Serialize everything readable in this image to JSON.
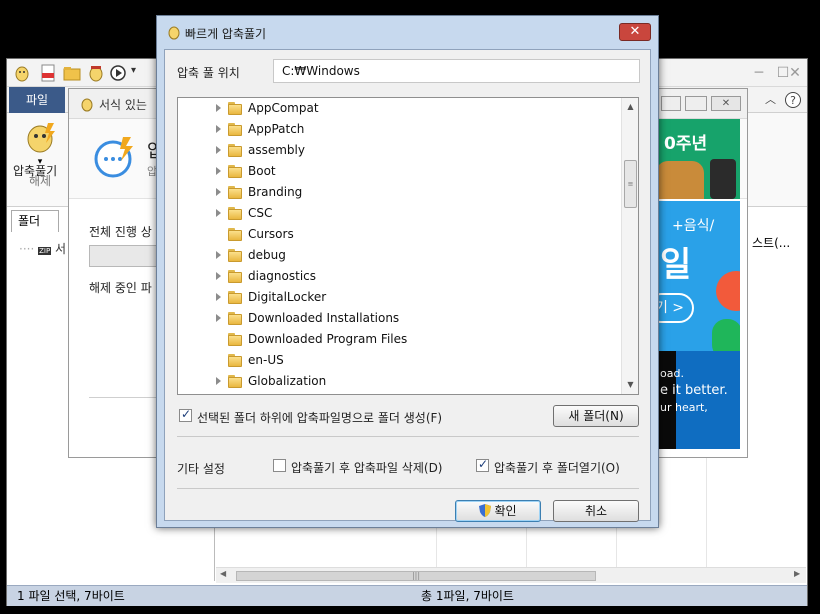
{
  "main_window": {
    "file_tab": "파일",
    "extract_button": "압축풀기",
    "extract_group": "해제",
    "folder_tab": "폴더",
    "tree_item": "서",
    "column_fragment": "스트(...",
    "status_left": "1 파일 선택,  7바이트",
    "status_center": "총 1파일,  7바이트"
  },
  "progress_window": {
    "title": "서식 있는",
    "header_fragment": "압",
    "header_sub": "압",
    "overall_label": "전체 진행 상",
    "current_label": "해제 중인 파"
  },
  "ad": {
    "top_text": "0주년",
    "mid_text1": "+음식/",
    "mid_text2": "일",
    "pill_text": "기 >",
    "bot_text1": "oad.",
    "bot_text2": "e it better.",
    "bot_text3": "ur heart,"
  },
  "dialog": {
    "title": "빠르게 압축풀기",
    "close_symbol": "✕",
    "location_label": "압축 풀 위치",
    "location_value": "C:₩Windows",
    "folders": [
      {
        "name": "AppCompat",
        "expandable": true
      },
      {
        "name": "AppPatch",
        "expandable": true
      },
      {
        "name": "assembly",
        "expandable": true
      },
      {
        "name": "Boot",
        "expandable": true
      },
      {
        "name": "Branding",
        "expandable": true
      },
      {
        "name": "CSC",
        "expandable": true
      },
      {
        "name": "Cursors",
        "expandable": false
      },
      {
        "name": "debug",
        "expandable": true
      },
      {
        "name": "diagnostics",
        "expandable": true
      },
      {
        "name": "DigitalLocker",
        "expandable": true
      },
      {
        "name": "Downloaded Installations",
        "expandable": true
      },
      {
        "name": "Downloaded Program Files",
        "expandable": false
      },
      {
        "name": "en-US",
        "expandable": false
      },
      {
        "name": "Globalization",
        "expandable": true
      }
    ],
    "create_subfolder_label": "선택된 폴더 하위에 압축파일명으로 폴더 생성(F)",
    "create_subfolder_checked": true,
    "new_folder_button": "새 폴더(N)",
    "other_settings_label": "기타 설정",
    "delete_after_label": "압축풀기 후 압축파일 삭제(D)",
    "delete_after_checked": false,
    "open_folder_label": "압축풀기 후 폴더열기(O)",
    "open_folder_checked": true,
    "ok_button": "확인",
    "cancel_button": "취소"
  },
  "colors": {
    "file_tab": "#3b5a89",
    "dialog_frame": "#c7d9ee",
    "close_button": "#c9463d",
    "statusbar": "#c8d3e3"
  }
}
